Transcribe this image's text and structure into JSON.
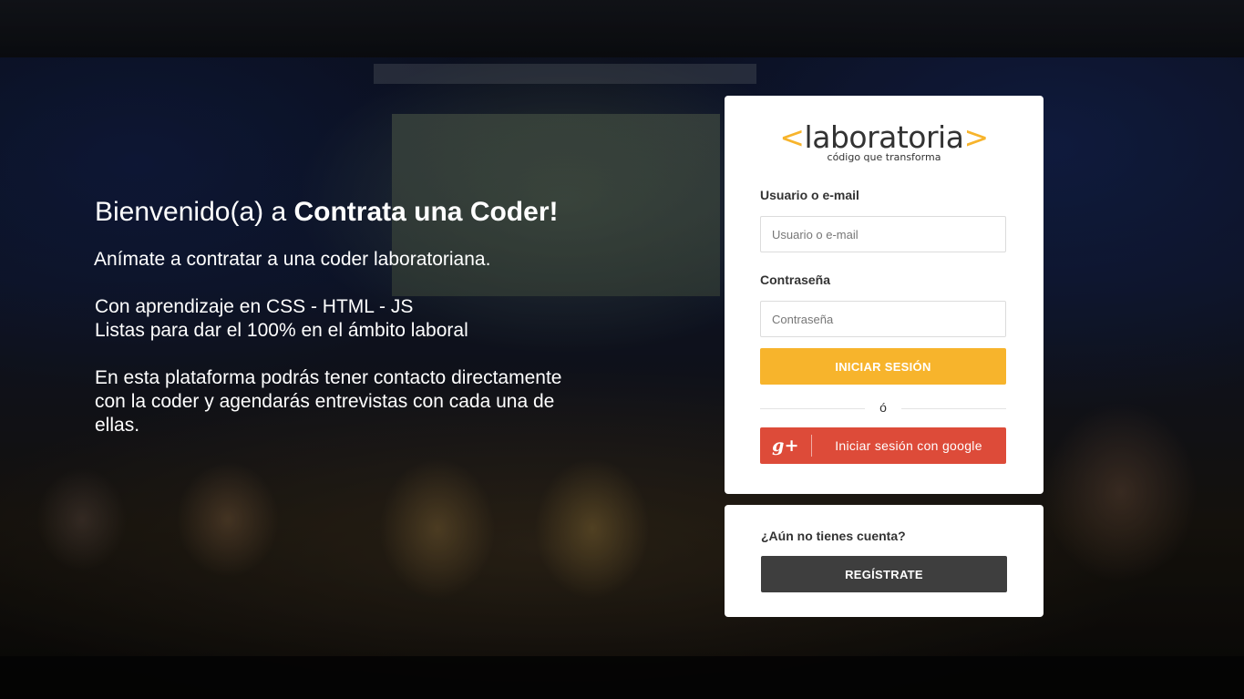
{
  "hero": {
    "title_prefix": "Bienvenido(a) a ",
    "title_strong": "Contrata una Coder!",
    "subtitle": "Anímate a contratar a una coder laboratoriana.",
    "lines_1": [
      "Con aprendizaje en CSS - HTML - JS",
      "Listas para dar el 100% en el ámbito laboral"
    ],
    "lines_2": [
      "En esta plataforma podrás tener contacto directamente",
      "con la coder y agendarás entrevistas con cada una de",
      "ellas."
    ]
  },
  "logo": {
    "bracket_open": "<",
    "name": "laboratoria",
    "bracket_close": ">",
    "tagline": "código que transforma"
  },
  "login": {
    "user_label": "Usuario o e-mail",
    "user_placeholder": "Usuario o e-mail",
    "password_label": "Contraseña",
    "password_placeholder": "Contraseña",
    "submit_label": "INICIAR SESIÓN",
    "divider_text": "ó",
    "google_icon": "g+",
    "google_label": "Iniciar sesión con google"
  },
  "register": {
    "question": "¿Aún no tienes cuenta?",
    "button_label": "REGÍSTRATE"
  },
  "colors": {
    "accent": "#f7b42c",
    "google": "#dd4b39",
    "dark_button": "#3e3e3e"
  }
}
